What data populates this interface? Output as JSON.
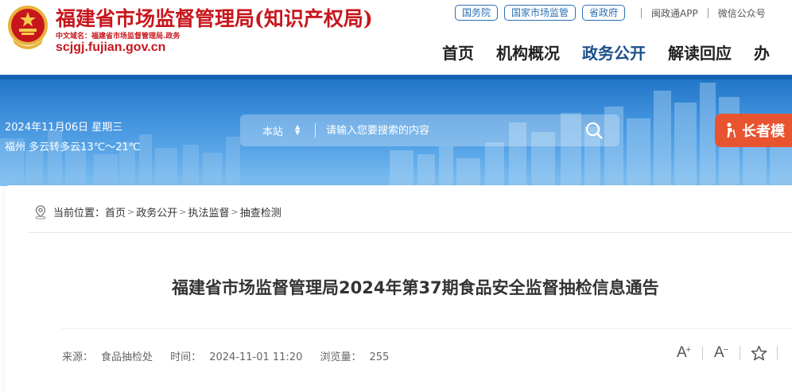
{
  "header": {
    "site_title": "福建省市场监督管理局(知识产权局)",
    "domain_cn": "中文域名：福建省市场监督管理局.政务",
    "domain_en": "scjgj.fujian.gov.cn",
    "top_links": [
      "国务院",
      "国家市场监管",
      "省政府"
    ],
    "app_link": "闽政通APP",
    "wechat_link": "微信公众号",
    "brand_color": "#c8161d"
  },
  "nav": {
    "items": [
      "首页",
      "机构概况",
      "政务公开",
      "解读回应",
      "办"
    ],
    "active": "政务公开",
    "active_color": "#1a4f8b"
  },
  "banner": {
    "date": "2024年11月06日 星期三",
    "weather": "福州 多云转多云13℃～21℃",
    "search_scope": "本站",
    "search_placeholder": "请输入您要搜索的内容",
    "elder_label": "长者模"
  },
  "breadcrumb": {
    "prefix": "当前位置：",
    "items": [
      "首页",
      "政务公开",
      "执法监督",
      "抽查检测"
    ]
  },
  "article": {
    "title": "福建省市场监督管理局2024年第37期食品安全监督抽检信息通告",
    "source_label": "来源：",
    "source_value": "食品抽检处",
    "time_label": "时间：",
    "time_value": "2024-11-01 11:20",
    "views_label": "浏览量：",
    "views_value": "255"
  },
  "tools": {
    "font_up": "A",
    "font_up_sup": "+",
    "font_down": "A",
    "font_down_sup": "−"
  }
}
